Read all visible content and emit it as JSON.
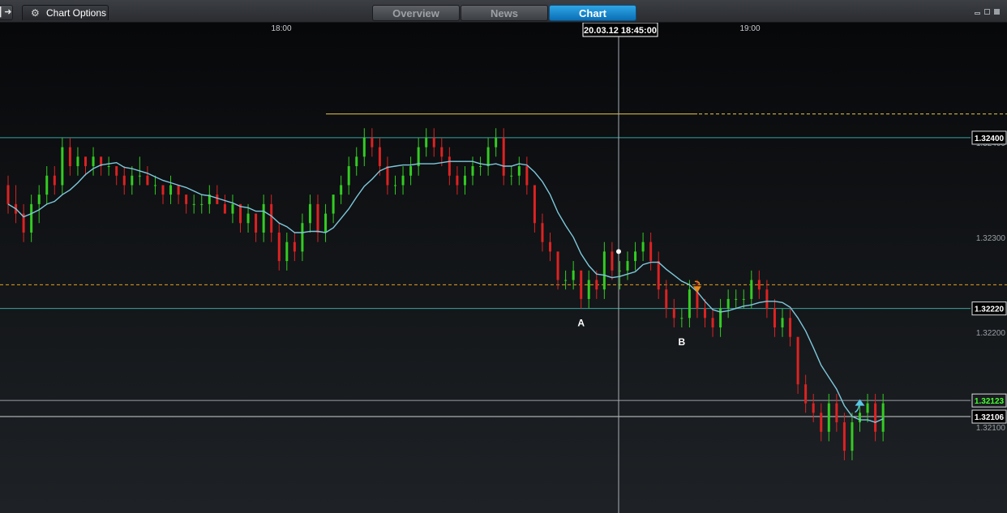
{
  "toolbar": {
    "exit_icon": "exit-arrow-icon",
    "exit_label": "▌➜",
    "chart_options_label": "Chart Options",
    "gear_icon": "gear-icon",
    "tabs": [
      {
        "label": "Overview",
        "active": false
      },
      {
        "label": "News",
        "active": false
      },
      {
        "label": "Chart",
        "active": true
      }
    ],
    "window_controls": [
      "minimize-icon",
      "restore-icon",
      "close-icon"
    ]
  },
  "chart_data": {
    "type": "candlestick",
    "instrument_timeframe": "1-minute",
    "time_axis_labels": [
      "18:00",
      "19:00"
    ],
    "crosshair_time_label": "20.03.12 18:45:00",
    "y_range": [
      1.3203,
      1.3247
    ],
    "y_tick_labels": [
      "1.32400",
      "1.32300",
      "1.32200",
      "1.32100"
    ],
    "horizontal_lines": [
      {
        "price": 1.324,
        "label": "1.32400",
        "color": "#3aa3a0",
        "style": "solid"
      },
      {
        "price": 1.3222,
        "label": "1.32220",
        "color": "#3aa3a0",
        "style": "solid"
      },
      {
        "price": 1.32123,
        "label": "1.32123",
        "color": "#9aa0a6",
        "style": "solid",
        "current_price": true
      },
      {
        "price": 1.32106,
        "label": "1.32106",
        "color": "#cfd3d6",
        "style": "solid"
      }
    ],
    "dashed_levels": [
      {
        "price": 1.32425,
        "color": "#e8c84a"
      },
      {
        "price": 1.32245,
        "color": "#e8a020"
      }
    ],
    "annotations": [
      {
        "label": "A",
        "time_index": 74
      },
      {
        "label": "B",
        "time_index": 87
      }
    ],
    "signals": [
      {
        "type": "sell",
        "time_index": 89,
        "price": 1.3224
      },
      {
        "type": "buy",
        "time_index": 110,
        "price": 1.3212
      }
    ],
    "moving_average": {
      "name": "",
      "color": "#7ec8dc"
    },
    "colors": {
      "up": "#33cc22",
      "down": "#dd2222",
      "background_top": "#07080a",
      "background_bottom": "#1e2226"
    },
    "candles": [
      [
        1.3235,
        1.3236,
        1.3232,
        1.3233
      ],
      [
        1.3233,
        1.3235,
        1.3231,
        1.3232
      ],
      [
        1.3232,
        1.3233,
        1.3229,
        1.323
      ],
      [
        1.323,
        1.3234,
        1.3229,
        1.3233
      ],
      [
        1.3233,
        1.3235,
        1.3231,
        1.3234
      ],
      [
        1.3234,
        1.3237,
        1.3233,
        1.3236
      ],
      [
        1.3236,
        1.3237,
        1.3234,
        1.3235
      ],
      [
        1.3235,
        1.324,
        1.3234,
        1.3239
      ],
      [
        1.3239,
        1.324,
        1.3236,
        1.3237
      ],
      [
        1.3237,
        1.3239,
        1.3236,
        1.3238
      ],
      [
        1.3238,
        1.3238,
        1.3236,
        1.3237
      ],
      [
        1.3237,
        1.3239,
        1.3236,
        1.3238
      ],
      [
        1.3238,
        1.3238,
        1.3236,
        1.3237
      ],
      [
        1.3237,
        1.3238,
        1.3236,
        1.3237
      ],
      [
        1.3237,
        1.3237,
        1.3235,
        1.3236
      ],
      [
        1.3236,
        1.3237,
        1.3234,
        1.3235
      ],
      [
        1.3235,
        1.3237,
        1.3234,
        1.3236
      ],
      [
        1.3236,
        1.3238,
        1.3235,
        1.3236
      ],
      [
        1.3236,
        1.3237,
        1.3235,
        1.3235
      ],
      [
        1.3235,
        1.3236,
        1.3234,
        1.3235
      ],
      [
        1.3235,
        1.3235,
        1.3233,
        1.3234
      ],
      [
        1.3234,
        1.3236,
        1.3233,
        1.3235
      ],
      [
        1.3235,
        1.3235,
        1.3233,
        1.3234
      ],
      [
        1.3234,
        1.3234,
        1.3232,
        1.3233
      ],
      [
        1.3233,
        1.3234,
        1.3232,
        1.3233
      ],
      [
        1.3233,
        1.3234,
        1.3232,
        1.3233
      ],
      [
        1.3233,
        1.3235,
        1.3232,
        1.3234
      ],
      [
        1.3234,
        1.3235,
        1.3233,
        1.3233
      ],
      [
        1.3233,
        1.3234,
        1.3232,
        1.3232
      ],
      [
        1.3232,
        1.3234,
        1.3231,
        1.3233
      ],
      [
        1.3233,
        1.3233,
        1.323,
        1.3231
      ],
      [
        1.3231,
        1.3233,
        1.323,
        1.3232
      ],
      [
        1.3232,
        1.3232,
        1.3229,
        1.323
      ],
      [
        1.323,
        1.3234,
        1.3229,
        1.3233
      ],
      [
        1.3233,
        1.3234,
        1.3229,
        1.323
      ],
      [
        1.323,
        1.3231,
        1.3226,
        1.3227
      ],
      [
        1.3227,
        1.323,
        1.3226,
        1.3229
      ],
      [
        1.3229,
        1.323,
        1.3227,
        1.3228
      ],
      [
        1.3228,
        1.3232,
        1.3227,
        1.3231
      ],
      [
        1.3231,
        1.3234,
        1.323,
        1.3233
      ],
      [
        1.3233,
        1.3234,
        1.3229,
        1.323
      ],
      [
        1.323,
        1.3233,
        1.3229,
        1.3232
      ],
      [
        1.3232,
        1.3234,
        1.3231,
        1.3234
      ],
      [
        1.3234,
        1.3236,
        1.3233,
        1.3235
      ],
      [
        1.3235,
        1.3238,
        1.3234,
        1.3237
      ],
      [
        1.3237,
        1.3239,
        1.3236,
        1.3238
      ],
      [
        1.3238,
        1.3241,
        1.3237,
        1.324
      ],
      [
        1.324,
        1.3241,
        1.3238,
        1.3239
      ],
      [
        1.3239,
        1.324,
        1.3236,
        1.3237
      ],
      [
        1.3237,
        1.3238,
        1.3234,
        1.3235
      ],
      [
        1.3235,
        1.3236,
        1.3234,
        1.3235
      ],
      [
        1.3235,
        1.3237,
        1.3234,
        1.3236
      ],
      [
        1.3236,
        1.3238,
        1.3235,
        1.3237
      ],
      [
        1.3237,
        1.324,
        1.3236,
        1.3239
      ],
      [
        1.3239,
        1.3241,
        1.3238,
        1.324
      ],
      [
        1.324,
        1.3241,
        1.3238,
        1.3239
      ],
      [
        1.3239,
        1.324,
        1.3237,
        1.3238
      ],
      [
        1.3238,
        1.3239,
        1.3235,
        1.3236
      ],
      [
        1.3236,
        1.3237,
        1.3234,
        1.3235
      ],
      [
        1.3235,
        1.3237,
        1.3234,
        1.3236
      ],
      [
        1.3236,
        1.3238,
        1.3235,
        1.3237
      ],
      [
        1.3237,
        1.3238,
        1.3236,
        1.3237
      ],
      [
        1.3237,
        1.324,
        1.3236,
        1.3239
      ],
      [
        1.3239,
        1.3241,
        1.3238,
        1.324
      ],
      [
        1.324,
        1.3241,
        1.3235,
        1.3236
      ],
      [
        1.3236,
        1.3237,
        1.3235,
        1.3236
      ],
      [
        1.3236,
        1.3238,
        1.3235,
        1.3237
      ],
      [
        1.3237,
        1.3238,
        1.3234,
        1.3235
      ],
      [
        1.3235,
        1.3235,
        1.323,
        1.3231
      ],
      [
        1.3231,
        1.3232,
        1.3228,
        1.3229
      ],
      [
        1.3229,
        1.323,
        1.3227,
        1.3228
      ],
      [
        1.3228,
        1.3228,
        1.3224,
        1.3225
      ],
      [
        1.3225,
        1.3226,
        1.3224,
        1.3225
      ],
      [
        1.3225,
        1.3227,
        1.3224,
        1.3226
      ],
      [
        1.3226,
        1.3226,
        1.3222,
        1.3223
      ],
      [
        1.3223,
        1.3226,
        1.3222,
        1.3225
      ],
      [
        1.3225,
        1.3226,
        1.3223,
        1.3224
      ],
      [
        1.3224,
        1.3229,
        1.3223,
        1.3228
      ],
      [
        1.3228,
        1.3229,
        1.3225,
        1.3226
      ],
      [
        1.3226,
        1.3227,
        1.3224,
        1.3226
      ],
      [
        1.3226,
        1.3228,
        1.3225,
        1.3227
      ],
      [
        1.3227,
        1.3229,
        1.3226,
        1.3228
      ],
      [
        1.3228,
        1.323,
        1.3227,
        1.3229
      ],
      [
        1.3229,
        1.323,
        1.3226,
        1.3227
      ],
      [
        1.3227,
        1.3228,
        1.3223,
        1.3224
      ],
      [
        1.3224,
        1.3225,
        1.3221,
        1.3222
      ],
      [
        1.3222,
        1.3223,
        1.322,
        1.3221
      ],
      [
        1.3221,
        1.3222,
        1.322,
        1.3221
      ],
      [
        1.3221,
        1.3225,
        1.322,
        1.3224
      ],
      [
        1.3224,
        1.3225,
        1.3221,
        1.3222
      ],
      [
        1.3222,
        1.3223,
        1.322,
        1.3221
      ],
      [
        1.3221,
        1.3222,
        1.3219,
        1.322
      ],
      [
        1.322,
        1.3223,
        1.3219,
        1.3222
      ],
      [
        1.3222,
        1.3224,
        1.3221,
        1.3223
      ],
      [
        1.3223,
        1.3224,
        1.3222,
        1.3223
      ],
      [
        1.3223,
        1.3224,
        1.3222,
        1.3223
      ],
      [
        1.3223,
        1.3226,
        1.3222,
        1.3225
      ],
      [
        1.3225,
        1.3226,
        1.3223,
        1.3224
      ],
      [
        1.3224,
        1.3225,
        1.3221,
        1.3222
      ],
      [
        1.3222,
        1.3223,
        1.3219,
        1.322
      ],
      [
        1.322,
        1.3222,
        1.3219,
        1.3221
      ],
      [
        1.3221,
        1.3222,
        1.3218,
        1.3219
      ],
      [
        1.3219,
        1.3219,
        1.3213,
        1.3214
      ],
      [
        1.3214,
        1.3215,
        1.3211,
        1.3212
      ],
      [
        1.3212,
        1.3213,
        1.321,
        1.3211
      ],
      [
        1.3211,
        1.3212,
        1.3208,
        1.3209
      ],
      [
        1.3209,
        1.3213,
        1.3208,
        1.3212
      ],
      [
        1.3212,
        1.3213,
        1.3209,
        1.321
      ],
      [
        1.321,
        1.3211,
        1.3206,
        1.3207
      ],
      [
        1.3207,
        1.3211,
        1.3206,
        1.321
      ],
      [
        1.321,
        1.3212,
        1.3209,
        1.3211
      ],
      [
        1.3211,
        1.3213,
        1.321,
        1.3212
      ],
      [
        1.3212,
        1.3213,
        1.3208,
        1.3209
      ],
      [
        1.3209,
        1.3213,
        1.3208,
        1.3212
      ]
    ]
  }
}
